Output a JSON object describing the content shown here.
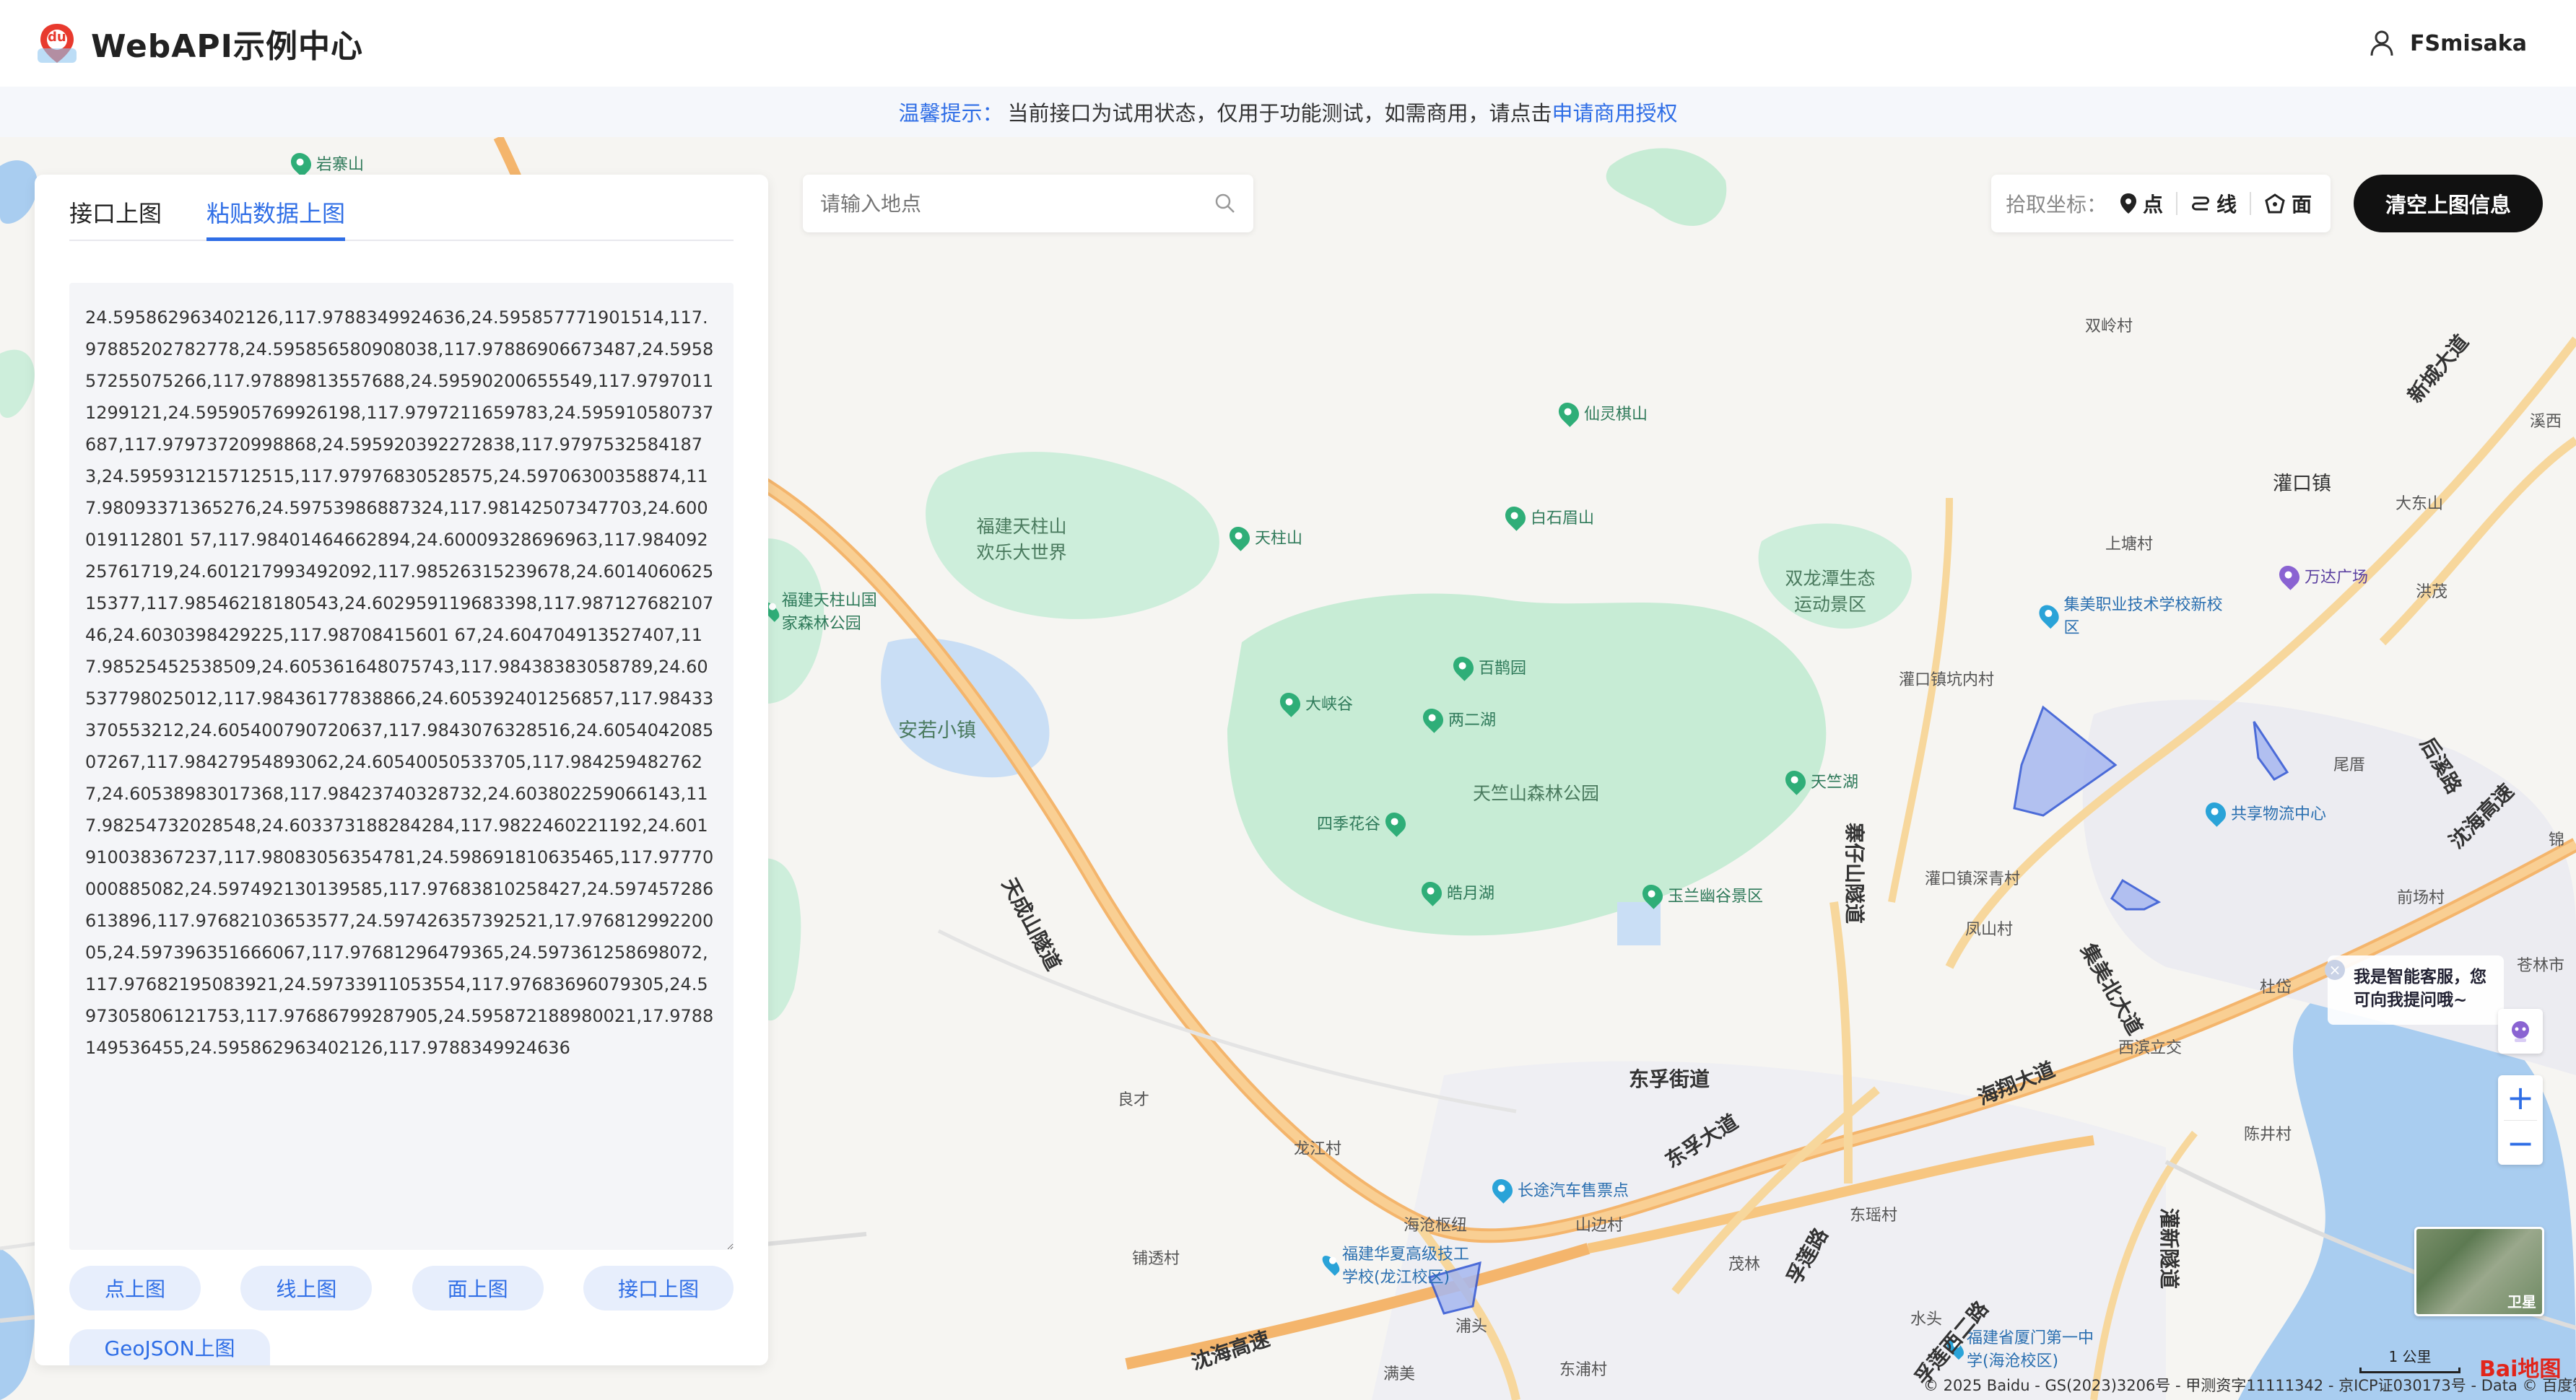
{
  "header": {
    "logo_text": "du",
    "title": "WebAPI示例中心",
    "username": "FSmisaka"
  },
  "notice": {
    "prefix": "温馨提示：",
    "text": "当前接口为试用状态，仅用于功能测试，如需商用，请点击",
    "link": "申请商用授权"
  },
  "panel": {
    "tabs": [
      {
        "label": "接口上图",
        "active": false
      },
      {
        "label": "粘贴数据上图",
        "active": true
      }
    ],
    "textarea_value": "24.595862963402126,117.9788349924636,24.595857771901514,117.97885202782778,24.595856580908038,117.97886906673487,24.595857255075266,117.97889813557688,24.59590200655549,117.97970111299121,24.595905769926198,117.9797211659783,24.595910580737687,117.97973720998868,24.595920392272838,117.97975325841873,24.595931215712515,117.97976830528575,24.59706300358874,117.98093371365276,24.59753986887324,117.98142507347703,24.600019112801 57,117.98401464662894,24.60009328696963,117.98409225761719,24.601217993492092,117.98526315239678,24.601406062515377,117.98546218180543,24.602959119683398,117.98712768210746,24.6030398429225,117.98708415601 67,24.604704913527407,117.98525452538509,24.605361648075743,117.98438383058789,24.60537798025012,117.98436177838866,24.605392401256857,117.98433370553212,24.605400790720637,117.9843076328516,24.605404208507267,117.98427954893062,24.60540050533705,117.9842594827627,24.60538983017368,117.98423740328732,24.603802259066143,117.98254732028548,24.603373188284284,117.9822460221192,24.601910038367237,117.98083056354781,24.598691810635465,117.97770000885082,24.597492130139585,117.97683810258427,24.597457286613896,117.97682103653577,24.597426357392521,17.97681299220005,24.597396351666067,117.97681296479365,24.597361258698072,117.97682195083921,24.59733911053554,117.97683696079305,24.597305806121753,117.97686799287905,24.595872188980021,17.9788149536455,24.595862963402126,117.9788349924636",
    "buttons_row1": [
      "点上图",
      "线上图",
      "面上图",
      "接口上图"
    ],
    "buttons_row2": [
      "GeoJSON上图"
    ]
  },
  "search": {
    "placeholder": "请输入地点"
  },
  "picker": {
    "label": "拾取坐标：",
    "point": "点",
    "line": "线",
    "polygon": "面"
  },
  "clear_button": "清空上图信息",
  "assistant": {
    "line1": "我是智能客服，您",
    "line2": "可向我提问哦~"
  },
  "satellite_label": "卫星",
  "scale_label": "1 公里",
  "copyright": "© 2025 Baidu - GS(2023)3206号 - 甲测资字11111342 - 京ICP证030173号 - Data © 百度智图",
  "baidu_logo": "Bai地图",
  "map_labels": {
    "pois": [
      {
        "name": "岩寨山",
        "type": "green"
      },
      {
        "name": "仙灵棋山",
        "type": "green"
      },
      {
        "name": "天柱山",
        "type": "green"
      },
      {
        "name": "白石眉山",
        "type": "green"
      },
      {
        "name": "福建天柱山国家森林公园",
        "type": "green"
      },
      {
        "name": "百鹊园",
        "type": "green"
      },
      {
        "name": "大峡谷",
        "type": "green"
      },
      {
        "name": "两二湖",
        "type": "green"
      },
      {
        "name": "天竺湖",
        "type": "green"
      },
      {
        "name": "四季花谷",
        "type": "green"
      },
      {
        "name": "皓月湖",
        "type": "green"
      },
      {
        "name": "玉兰幽谷景区",
        "type": "green"
      },
      {
        "name": "集美职业技术学校新校区",
        "type": "blue"
      },
      {
        "name": "万达广场",
        "type": "purple"
      },
      {
        "name": "共享物流中心",
        "type": "blue"
      },
      {
        "name": "长途汽车售票点",
        "type": "blue"
      },
      {
        "name": "福建华夏高级技工学校(龙江校区)",
        "type": "blue"
      },
      {
        "name": "福建省厦门第一中学(海沧校区)",
        "type": "blue"
      }
    ],
    "places": [
      "福建天柱山欢乐大世界",
      "双龙潭生态运动景区",
      "天竺山森林公园",
      "安若小镇",
      "双岭村",
      "灌口镇",
      "上塘村",
      "大东山",
      "洪茂",
      "灌口镇坑内村",
      "尾厝",
      "灌口镇深青村",
      "凤山村",
      "前场村",
      "杜岱",
      "西滨立交",
      "陈井村",
      "良才",
      "龙江村",
      "海沧枢纽",
      "山边村",
      "茂林",
      "东瑶村",
      "铺透村",
      "浦头",
      "满美",
      "东浦村",
      "水头",
      "苍林市",
      "溪西",
      "锦"
    ],
    "roads": [
      "天成山隧道",
      "寨仔山隧道",
      "东孚街道",
      "东孚大道",
      "孚莲路",
      "海翔大道",
      "灌新隧道",
      "集美北大道",
      "沈海高速",
      "新城大道",
      "孚莲西二路",
      "沈海高速",
      "后溪路"
    ]
  }
}
